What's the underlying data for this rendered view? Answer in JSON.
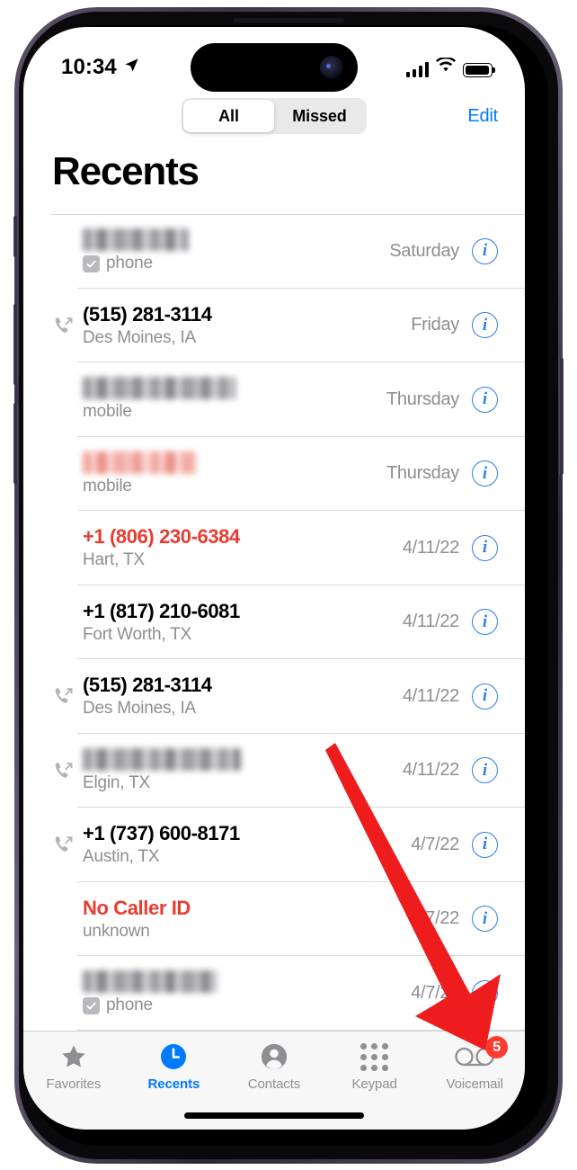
{
  "status_bar": {
    "time": "10:34",
    "location_icon": "location-arrow-icon",
    "signal_icon": "cellular-signal-icon",
    "wifi_icon": "wifi-icon",
    "battery_icon": "battery-icon"
  },
  "nav": {
    "segments": [
      {
        "label": "All",
        "active": true
      },
      {
        "label": "Missed",
        "active": false
      }
    ],
    "edit_label": "Edit",
    "title": "Recents"
  },
  "colors": {
    "accent_blue": "#007aff",
    "missed_red": "#ea3b30",
    "badge_red": "#ff3b30",
    "secondary_gray": "#8e8e93",
    "annotation_red": "#ee1c1c"
  },
  "calls": [
    {
      "name": "",
      "redacted": true,
      "redacted_color": "gray",
      "redacted_width": 118,
      "sub": "phone",
      "sub_badge": "check-badge",
      "date": "Saturday",
      "call_type": "none",
      "missed": false
    },
    {
      "name": "(515) 281-3114",
      "redacted": false,
      "sub": "Des Moines, IA",
      "sub_badge": "",
      "date": "Friday",
      "call_type": "outgoing",
      "missed": false
    },
    {
      "name": "",
      "redacted": true,
      "redacted_color": "gray",
      "redacted_width": 170,
      "sub": "mobile",
      "sub_badge": "",
      "date": "Thursday",
      "call_type": "none",
      "missed": false
    },
    {
      "name": "",
      "redacted": true,
      "redacted_color": "red",
      "redacted_width": 126,
      "sub": "mobile",
      "sub_badge": "",
      "date": "Thursday",
      "call_type": "none",
      "missed": true
    },
    {
      "name": "+1 (806) 230-6384",
      "redacted": false,
      "sub": "Hart, TX",
      "sub_badge": "",
      "date": "4/11/22",
      "call_type": "none",
      "missed": true
    },
    {
      "name": "+1 (817) 210-6081",
      "redacted": false,
      "sub": "Fort Worth, TX",
      "sub_badge": "",
      "date": "4/11/22",
      "call_type": "none",
      "missed": false
    },
    {
      "name": "(515) 281-3114",
      "redacted": false,
      "sub": "Des Moines, IA",
      "sub_badge": "",
      "date": "4/11/22",
      "call_type": "outgoing",
      "missed": false
    },
    {
      "name": "",
      "redacted": true,
      "redacted_color": "gray",
      "redacted_width": 176,
      "sub": "Elgin, TX",
      "sub_badge": "",
      "date": "4/11/22",
      "call_type": "outgoing",
      "missed": false
    },
    {
      "name": "+1 (737) 600-8171",
      "redacted": false,
      "sub": "Austin, TX",
      "sub_badge": "",
      "date": "4/7/22",
      "call_type": "outgoing",
      "missed": false
    },
    {
      "name": "No Caller ID",
      "redacted": false,
      "sub": "unknown",
      "sub_badge": "",
      "date": "4/7/22",
      "call_type": "none",
      "missed": true
    },
    {
      "name": "",
      "redacted": true,
      "redacted_color": "gray",
      "redacted_width": 150,
      "sub": "phone",
      "sub_badge": "check-badge",
      "date": "4/7/22",
      "call_type": "none",
      "missed": false
    }
  ],
  "info_button_label": "i",
  "tab_bar": {
    "items": [
      {
        "label": "Favorites",
        "icon": "star-icon",
        "active": false,
        "badge": ""
      },
      {
        "label": "Recents",
        "icon": "clock-icon",
        "active": true,
        "badge": ""
      },
      {
        "label": "Contacts",
        "icon": "person-icon",
        "active": false,
        "badge": ""
      },
      {
        "label": "Keypad",
        "icon": "keypad-icon",
        "active": false,
        "badge": ""
      },
      {
        "label": "Voicemail",
        "icon": "voicemail-icon",
        "active": false,
        "badge": "5"
      }
    ]
  },
  "annotation": {
    "type": "arrow",
    "points_to": "voicemail-tab"
  }
}
